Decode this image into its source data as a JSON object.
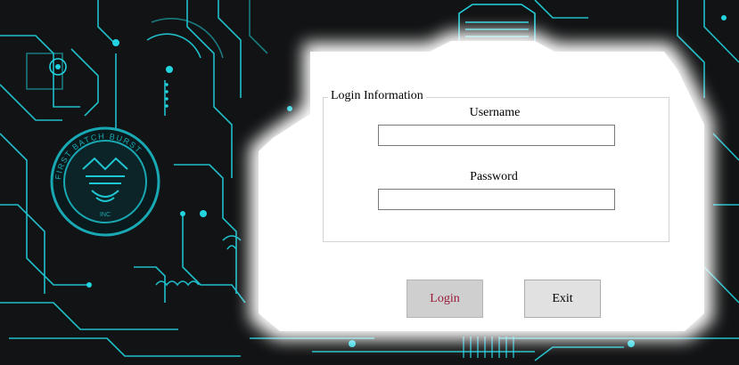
{
  "form": {
    "group_title": "Login Information",
    "username_label": "Username",
    "username_value": "",
    "password_label": "Password",
    "password_value": "",
    "login_label": "Login",
    "exit_label": "Exit"
  },
  "logo": {
    "caption_top": "FIRST BATCH BURST",
    "caption_bottom": "INC"
  },
  "colors": {
    "background": "#121314",
    "circuit": "#22d3e0",
    "panel": "#ffffff",
    "login_text": "#9b1b3b"
  }
}
